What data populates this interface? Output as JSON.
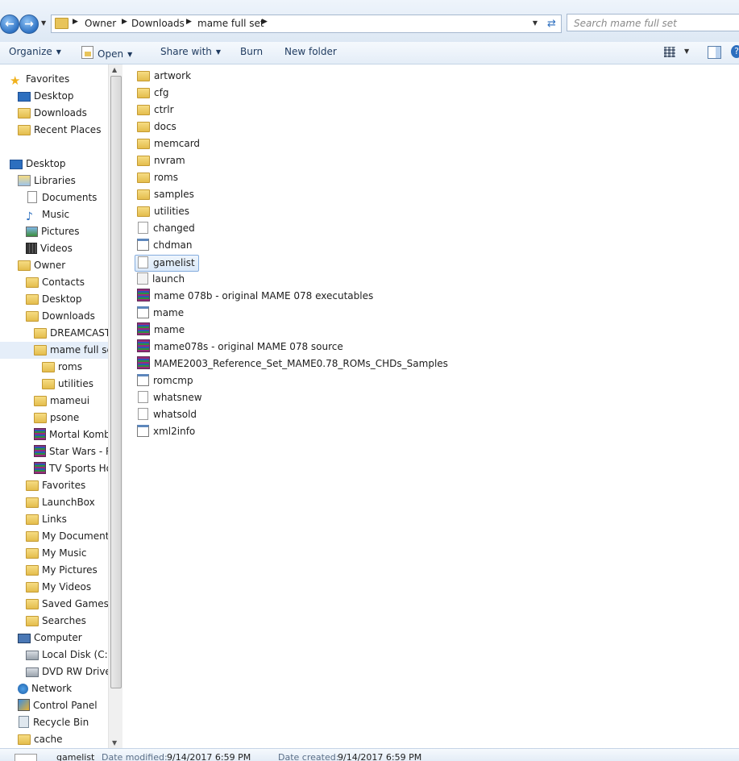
{
  "address": {
    "crumbs": [
      "Owner",
      "Downloads",
      "mame full set"
    ],
    "search_placeholder": "Search mame full set"
  },
  "toolbar": {
    "organize": "Organize",
    "open": "Open",
    "share_with": "Share with",
    "burn": "Burn",
    "new_folder": "New folder"
  },
  "nav": {
    "items": [
      {
        "label": "Favorites",
        "icon": "star-icon"
      },
      {
        "label": "Desktop",
        "icon": "desktop-icon"
      },
      {
        "label": "Downloads",
        "icon": "folder-icon"
      },
      {
        "label": "Recent Places",
        "icon": "folder-icon"
      },
      {
        "label": "Desktop",
        "icon": "desktop-icon"
      },
      {
        "label": "Libraries",
        "icon": "libraries-icon"
      },
      {
        "label": "Documents",
        "icon": "document-icon"
      },
      {
        "label": "Music",
        "icon": "music-icon"
      },
      {
        "label": "Pictures",
        "icon": "pictures-icon"
      },
      {
        "label": "Videos",
        "icon": "videos-icon"
      },
      {
        "label": "Owner",
        "icon": "folder-icon"
      },
      {
        "label": "Contacts",
        "icon": "folder-icon"
      },
      {
        "label": "Desktop",
        "icon": "folder-icon"
      },
      {
        "label": "Downloads",
        "icon": "folder-icon"
      },
      {
        "label": "DREAMCAST",
        "icon": "folder-icon"
      },
      {
        "label": "mame full set",
        "icon": "folder-icon"
      },
      {
        "label": "roms",
        "icon": "folder-icon"
      },
      {
        "label": "utilities",
        "icon": "folder-icon"
      },
      {
        "label": "mameui",
        "icon": "folder-icon"
      },
      {
        "label": "psone",
        "icon": "folder-icon"
      },
      {
        "label": "Mortal Komb",
        "icon": "archive-icon"
      },
      {
        "label": "Star Wars - R",
        "icon": "archive-icon"
      },
      {
        "label": "TV Sports Ho",
        "icon": "archive-icon"
      },
      {
        "label": "Favorites",
        "icon": "folder-icon"
      },
      {
        "label": "LaunchBox",
        "icon": "folder-icon"
      },
      {
        "label": "Links",
        "icon": "folder-icon"
      },
      {
        "label": "My Documents",
        "icon": "folder-icon"
      },
      {
        "label": "My Music",
        "icon": "folder-icon"
      },
      {
        "label": "My Pictures",
        "icon": "folder-icon"
      },
      {
        "label": "My Videos",
        "icon": "folder-icon"
      },
      {
        "label": "Saved Games",
        "icon": "folder-icon"
      },
      {
        "label": "Searches",
        "icon": "folder-icon"
      },
      {
        "label": "Computer",
        "icon": "computer-icon"
      },
      {
        "label": "Local Disk (C:)",
        "icon": "drive-icon"
      },
      {
        "label": "DVD RW Drive (",
        "icon": "dvd-drive-icon"
      },
      {
        "label": "Network",
        "icon": "network-icon"
      },
      {
        "label": "Control Panel",
        "icon": "control-panel-icon"
      },
      {
        "label": "Recycle Bin",
        "icon": "recycle-bin-icon"
      },
      {
        "label": "cache",
        "icon": "folder-icon"
      }
    ],
    "selected": "mame full set"
  },
  "files": [
    {
      "name": "artwork",
      "icon": "folder-icon"
    },
    {
      "name": "cfg",
      "icon": "folder-icon"
    },
    {
      "name": "ctrlr",
      "icon": "folder-icon"
    },
    {
      "name": "docs",
      "icon": "folder-icon"
    },
    {
      "name": "memcard",
      "icon": "folder-icon"
    },
    {
      "name": "nvram",
      "icon": "folder-icon"
    },
    {
      "name": "roms",
      "icon": "folder-icon"
    },
    {
      "name": "samples",
      "icon": "folder-icon"
    },
    {
      "name": "utilities",
      "icon": "folder-icon"
    },
    {
      "name": "changed",
      "icon": "text-file-icon"
    },
    {
      "name": "chdman",
      "icon": "application-icon"
    },
    {
      "name": "gamelist",
      "icon": "text-file-icon"
    },
    {
      "name": "launch",
      "icon": "settings-file-icon"
    },
    {
      "name": "mame 078b - original MAME 078 executables",
      "icon": "archive-icon"
    },
    {
      "name": "mame",
      "icon": "application-icon"
    },
    {
      "name": "mame",
      "icon": "archive-icon"
    },
    {
      "name": "mame078s - original MAME 078 source",
      "icon": "archive-icon"
    },
    {
      "name": "MAME2003_Reference_Set_MAME0.78_ROMs_CHDs_Samples",
      "icon": "archive-icon"
    },
    {
      "name": "romcmp",
      "icon": "application-icon"
    },
    {
      "name": "whatsnew",
      "icon": "text-file-icon"
    },
    {
      "name": "whatsold",
      "icon": "text-file-icon"
    },
    {
      "name": "xml2info",
      "icon": "application-icon"
    }
  ],
  "selected_file": "gamelist",
  "details": {
    "name": "gamelist",
    "modified_label": "Date modified:",
    "modified_value": "9/14/2017 6:59 PM",
    "created_label": "Date created:",
    "created_value": "9/14/2017 6:59 PM"
  }
}
